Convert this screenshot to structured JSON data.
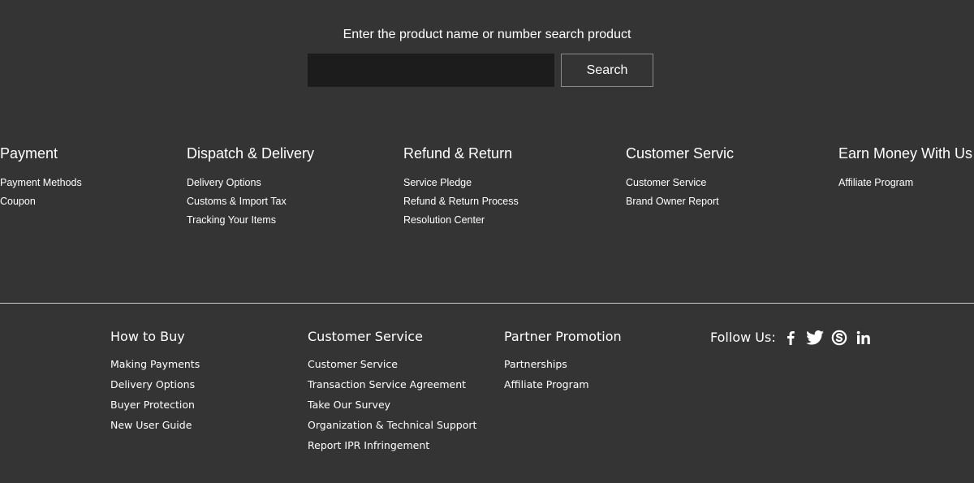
{
  "search": {
    "title": "Enter the product name or number search product",
    "input_value": "",
    "button_label": "Search"
  },
  "top_columns": [
    {
      "title": "Payment",
      "items": [
        "Payment Methods",
        "Coupon"
      ]
    },
    {
      "title": "Dispatch & Delivery",
      "items": [
        "Delivery Options",
        "Customs & Import Tax",
        "Tracking Your Items"
      ]
    },
    {
      "title": "Refund & Return",
      "items": [
        "Service Pledge",
        "Refund & Return Process",
        "Resolution Center"
      ]
    },
    {
      "title": "Customer Servic",
      "items": [
        "Customer Service",
        "Brand Owner Report"
      ]
    },
    {
      "title": "Earn Money With Us",
      "items": [
        "Affiliate Program"
      ]
    }
  ],
  "bottom_columns": [
    {
      "title": "How to Buy",
      "items": [
        "Making Payments",
        "Delivery Options",
        "Buyer Protection",
        "New User Guide"
      ]
    },
    {
      "title": "Customer Service",
      "items": [
        "Customer Service",
        "Transaction Service Agreement",
        "Take Our Survey",
        "Organization & Technical Support",
        "Report IPR Infringement"
      ]
    },
    {
      "title": "Partner Promotion",
      "items": [
        "Partnerships",
        "Affiliate Program"
      ]
    }
  ],
  "follow": {
    "label": "Follow Us:",
    "icons": [
      "facebook-icon",
      "twitter-icon",
      "skype-icon",
      "linkedin-icon"
    ]
  }
}
